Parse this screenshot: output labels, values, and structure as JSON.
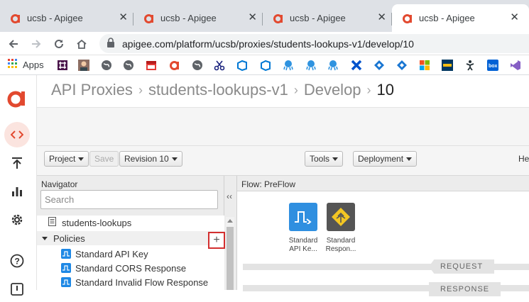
{
  "browser": {
    "tabs": [
      {
        "title": "ucsb - Apigee",
        "favicon": "apigee-logo-icon"
      },
      {
        "title": "ucsb - Apigee",
        "favicon": "apigee-logo-icon"
      },
      {
        "title": "ucsb - Apigee",
        "favicon": "apigee-logo-icon"
      },
      {
        "title": "ucsb - Apigee",
        "favicon": "apigee-logo-icon"
      }
    ],
    "url": "apigee.com/platform/ucsb/proxies/students-lookups-v1/develop/10",
    "bookmarks_apps_label": "Apps"
  },
  "app": {
    "breadcrumb": {
      "root": "API Proxies",
      "proxy": "students-lookups-v1",
      "section": "Develop",
      "revision": "10"
    },
    "toolbar": {
      "project_label": "Project",
      "save_label": "Save",
      "revision_label": "Revision 10",
      "tools_label": "Tools",
      "deployment_label": "Deployment",
      "help_label": "He"
    },
    "navigator": {
      "title": "Navigator",
      "search_placeholder": "Search",
      "collapse_label": "‹‹",
      "endpoint_item": "students-lookups",
      "policies_section": "Policies",
      "policies": [
        "Standard API Key",
        "Standard CORS Response",
        "Standard Invalid Flow Response"
      ]
    },
    "flow": {
      "title": "Flow: PreFlow",
      "steps": [
        {
          "label_line1": "Standard",
          "label_line2": "API Ke...",
          "icon": "verify-api-key-icon"
        },
        {
          "label_line1": "Standard",
          "label_line2": "Respon...",
          "icon": "response-flow-icon"
        }
      ],
      "request_label": "REQUEST",
      "response_label": "RESPONSE"
    }
  },
  "colors": {
    "apigee_red": "#e2492f",
    "policy_blue": "#1e88e5",
    "response_dark": "#555555",
    "response_yellow": "#f3c623",
    "highlight_red": "#d32f2f"
  }
}
